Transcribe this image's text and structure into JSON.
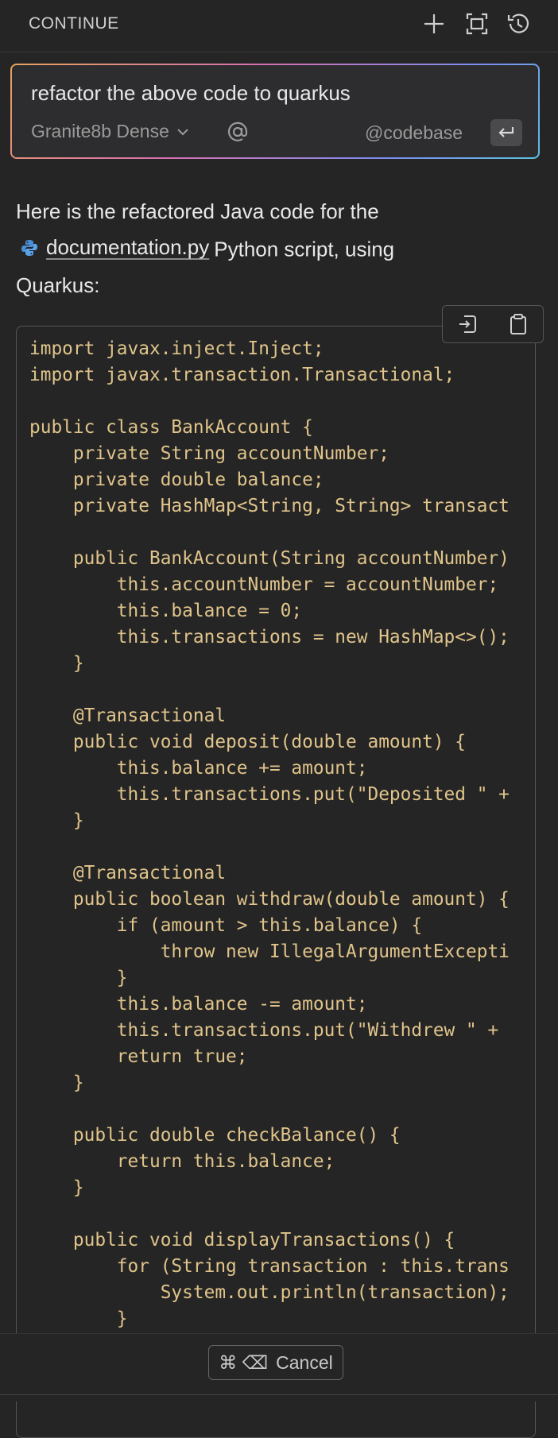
{
  "header": {
    "title": "CONTINUE",
    "icons": [
      "plus-icon",
      "fullscreen-icon",
      "history-icon"
    ]
  },
  "input": {
    "value": "refactor the above code to quarkus",
    "model": "Granite8b Dense",
    "mention_icon": "at-icon",
    "codebase": "@codebase",
    "enter_icon": "enter-icon"
  },
  "response": {
    "intro_part1": "Here is the refactored Java code for the",
    "file_name": "documentation.py",
    "intro_part2": "Python script, using",
    "intro_part3": "Quarkus:"
  },
  "code": {
    "lines": [
      "import javax.inject.Inject;",
      "import javax.transaction.Transactional;",
      "",
      "public class BankAccount {",
      "    private String accountNumber;",
      "    private double balance;",
      "    private HashMap<String, String> transact",
      "",
      "    public BankAccount(String accountNumber)",
      "        this.accountNumber = accountNumber;",
      "        this.balance = 0;",
      "        this.transactions = new HashMap<>();",
      "    }",
      "",
      "    @Transactional",
      "    public void deposit(double amount) {",
      "        this.balance += amount;",
      "        this.transactions.put(\"Deposited \" +",
      "    }",
      "",
      "    @Transactional",
      "    public boolean withdraw(double amount) {",
      "        if (amount > this.balance) {",
      "            throw new IllegalArgumentExcepti",
      "        }",
      "        this.balance -= amount;",
      "        this.transactions.put(\"Withdrew \" +",
      "        return true;",
      "    }",
      "",
      "    public double checkBalance() {",
      "        return this.balance;",
      "    }",
      "",
      "    public void displayTransactions() {",
      "        for (String transaction : this.trans",
      "            System.out.println(transaction);",
      "        }"
    ]
  },
  "footer": {
    "shortcut": "⌘ ⌫",
    "cancel_label": "Cancel"
  },
  "colors": {
    "background": "#252526",
    "code_text": "#e0c48a",
    "text": "#e8e8e8"
  }
}
